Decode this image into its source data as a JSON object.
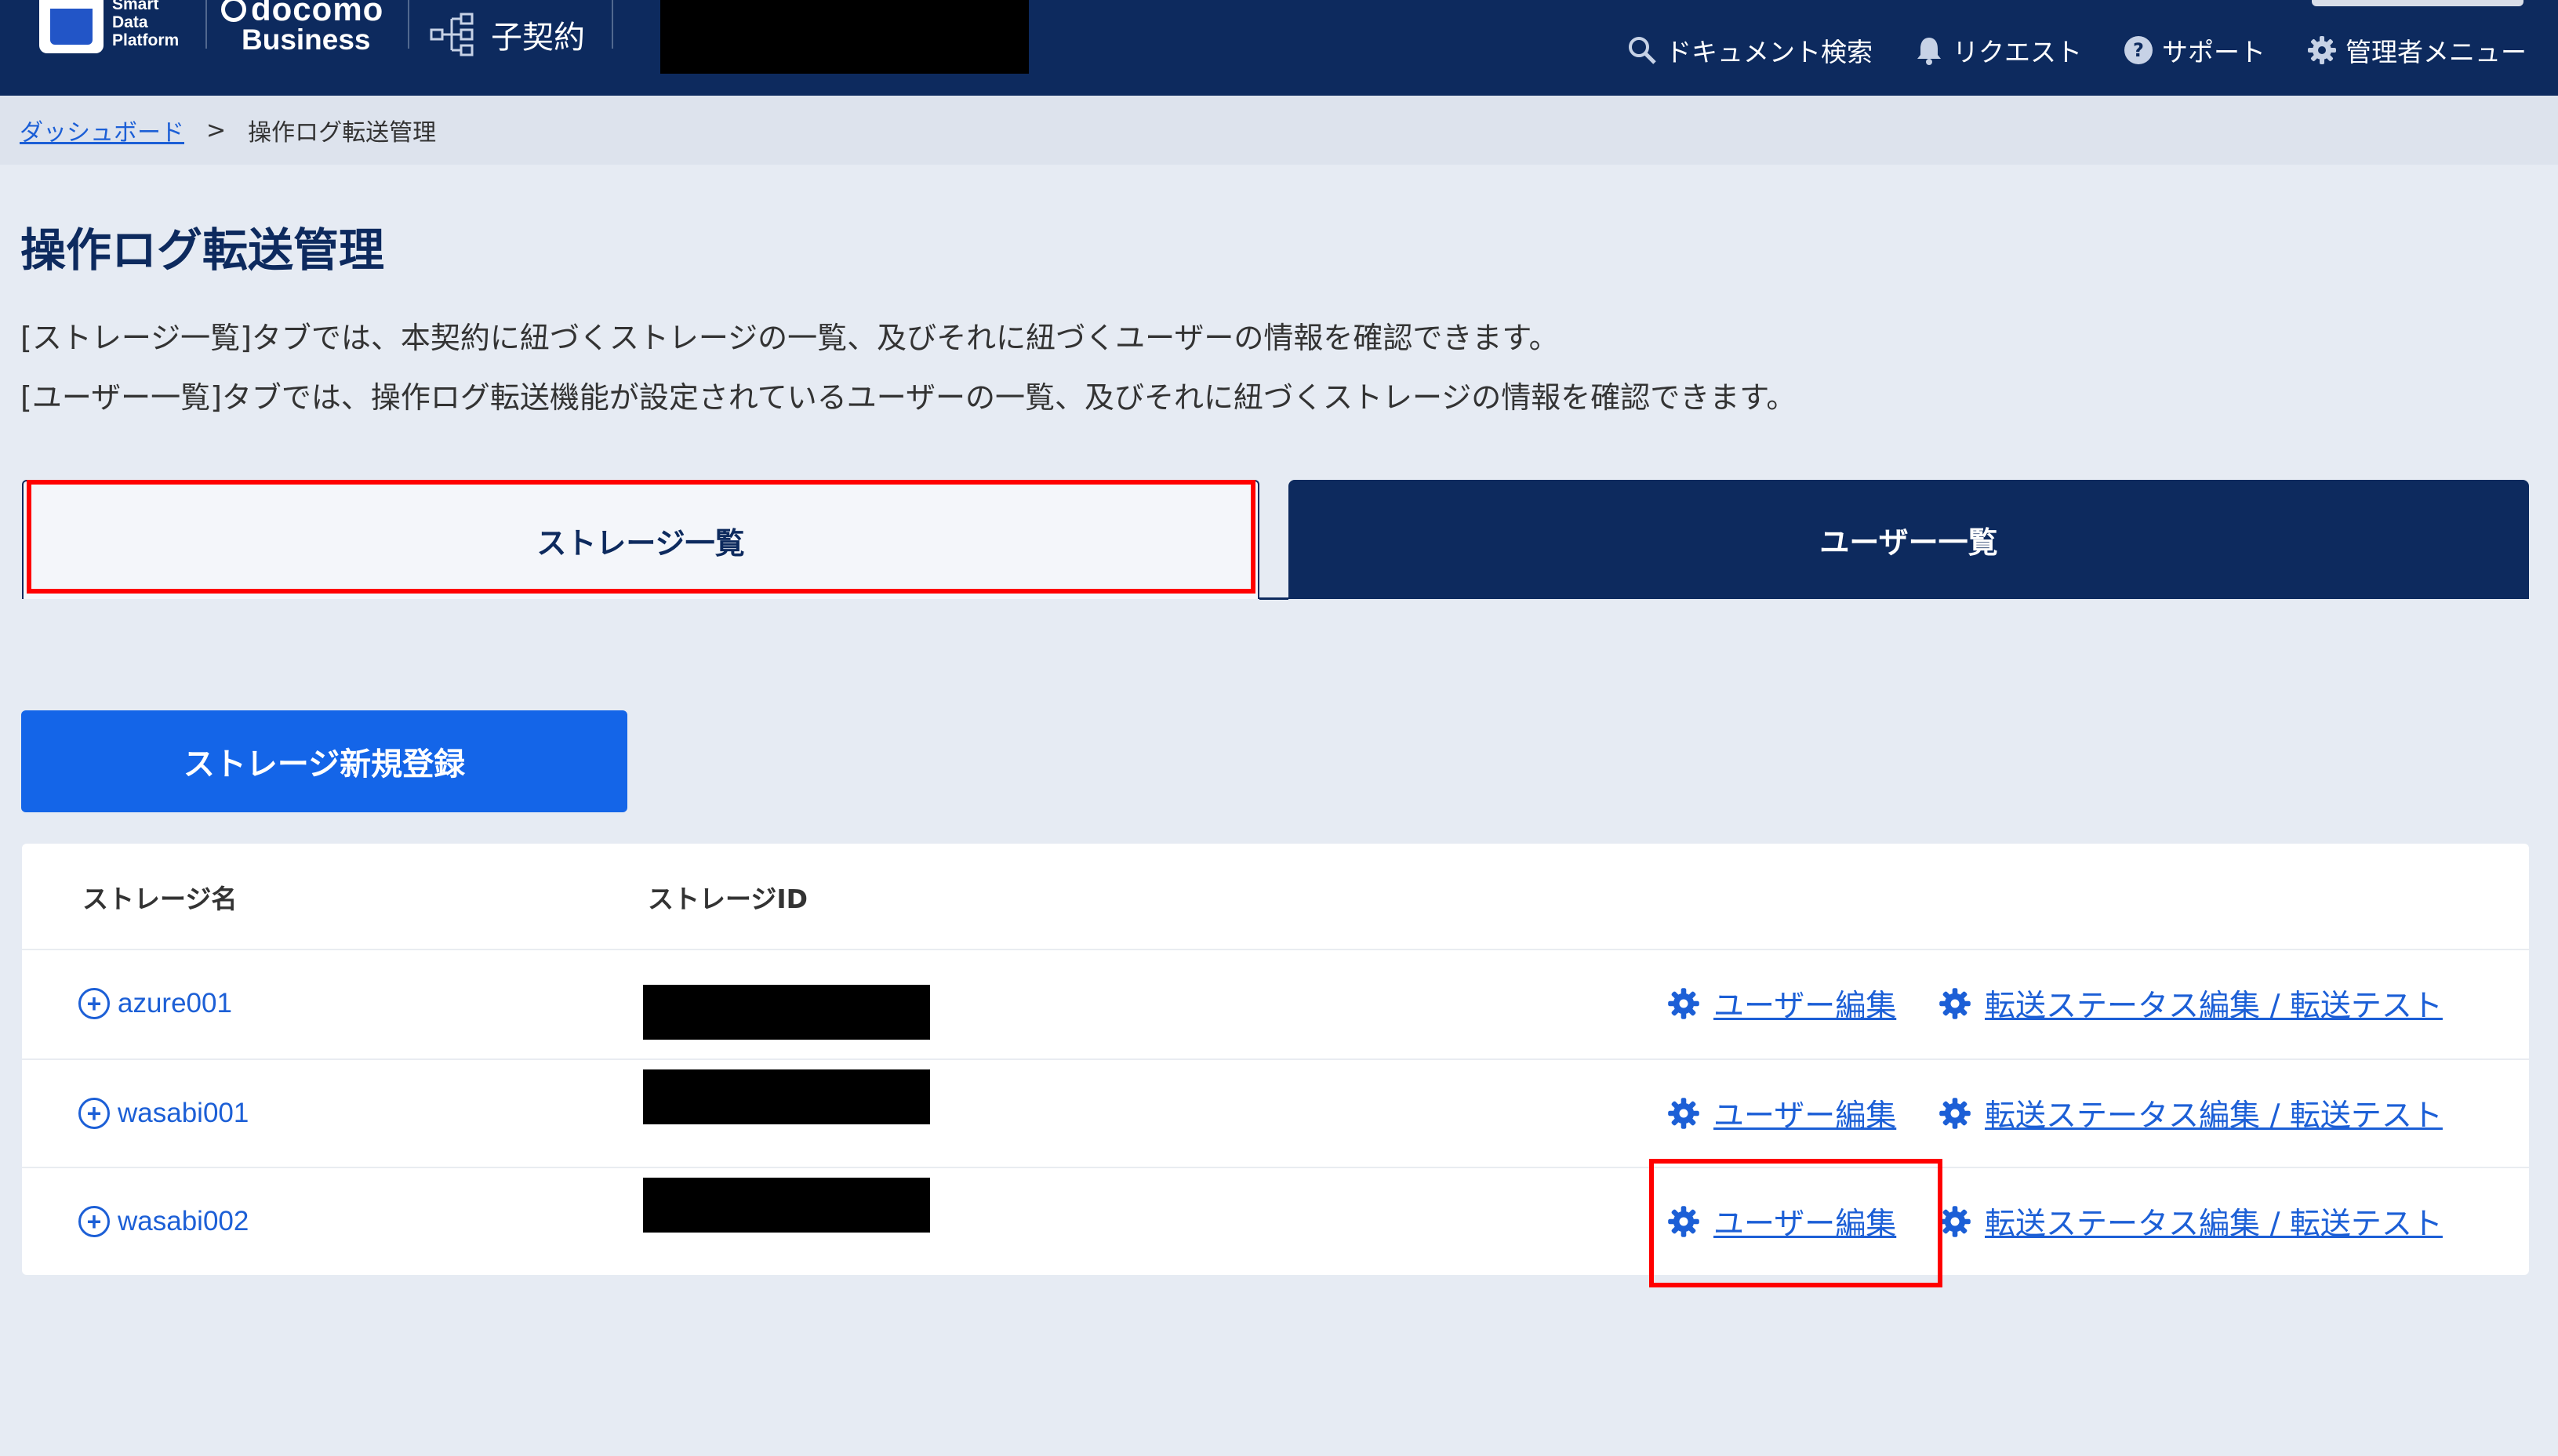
{
  "header": {
    "logo_line1": "Smart",
    "logo_line2": "Data",
    "logo_line3": "Platform",
    "brand_top": "docomo",
    "brand_bottom": "Business",
    "contract_label": "子契約",
    "nav": [
      {
        "label": "ドキュメント検索",
        "icon": "search-icon"
      },
      {
        "label": "リクエスト",
        "icon": "bell-icon"
      },
      {
        "label": "サポート",
        "icon": "help-icon"
      },
      {
        "label": "管理者メニュー",
        "icon": "gear-icon"
      }
    ]
  },
  "breadcrumb": {
    "home": "ダッシュボード",
    "separator": ">",
    "current": "操作ログ転送管理"
  },
  "page": {
    "title": "操作ログ転送管理",
    "description_1": "[ストレージ一覧]タブでは、本契約に紐づくストレージの一覧、及びそれに紐づくユーザーの情報を確認できます。",
    "description_2": "[ユーザー一覧]タブでは、操作ログ転送機能が設定されているユーザーの一覧、及びそれに紐づくストレージの情報を確認できます。"
  },
  "tabs": {
    "storage_list": "ストレージ一覧",
    "user_list": "ユーザー一覧"
  },
  "register_button": "ストレージ新規登録",
  "table": {
    "headers": [
      "ストレージ名",
      "ストレージID"
    ],
    "rows": [
      {
        "name": "azure001",
        "user_edit": "ユーザー編集",
        "transfer_edit": "転送ステータス編集 / 転送テスト"
      },
      {
        "name": "wasabi001",
        "user_edit": "ユーザー編集",
        "transfer_edit": "転送ステータス編集 / 転送テスト"
      },
      {
        "name": "wasabi002",
        "user_edit": "ユーザー編集",
        "transfer_edit": "転送ステータス編集 / 転送テスト"
      }
    ]
  },
  "colors": {
    "navy": "#0d2a5e",
    "link_blue": "#1c5fd6",
    "button_blue": "#1465e8",
    "highlight_red": "#ff0000"
  }
}
